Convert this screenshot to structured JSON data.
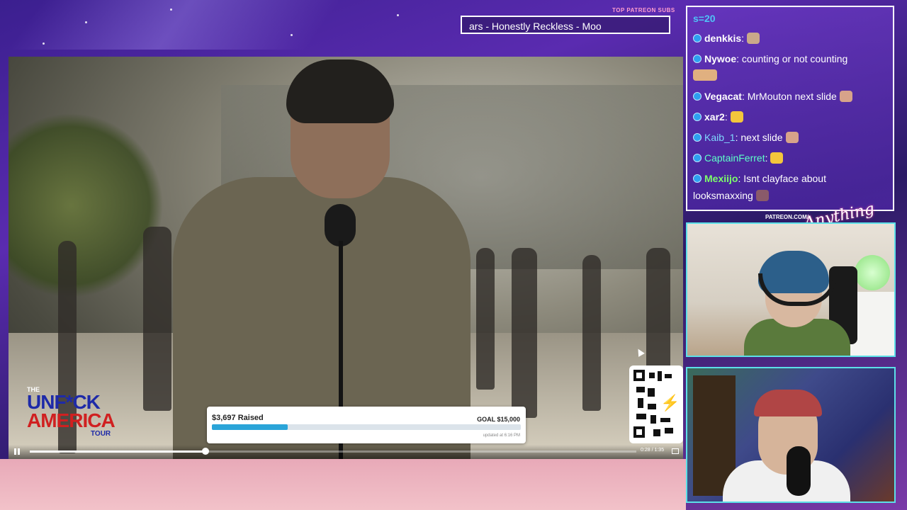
{
  "now_playing": {
    "label": "TOP PATREON SUBS",
    "text": "ars - Honestly Reckless - Moo"
  },
  "video": {
    "logo": {
      "line1": "THE",
      "line2": "UNF*CK",
      "line3": "AMERICA",
      "line4": "TOUR"
    },
    "donation": {
      "raised": "$3,697 Raised",
      "goal": "GOAL $15,000",
      "progress": 0.2465,
      "updated": "updated at 6:16 PM"
    },
    "player": {
      "progress": 0.29,
      "time": "0:28 / 1:35"
    }
  },
  "chat": {
    "top_line": "s=20",
    "messages": [
      {
        "user": "denkkis",
        "text": "",
        "user_color": "#ffffff",
        "emote_color": "#c9a98a"
      },
      {
        "user": "Nywoe",
        "text": "counting or not counting",
        "user_color": "#ffffff",
        "emote_color": "#e0b080"
      },
      {
        "user": "Vegacat",
        "text": "MrMouton next slide",
        "user_color": "#ffffff",
        "emote_color": "#d7a38a"
      },
      {
        "user": "xar2",
        "text": "",
        "user_color": "#ffffff",
        "emote_color": "#f3c63c"
      },
      {
        "user": "Kaib_1",
        "text": "next slide",
        "user_color": "#7fd8ff",
        "emote_color": "#d7a38a"
      },
      {
        "user": "CaptainFerret",
        "text": "",
        "user_color": "#5dffc8",
        "emote_color": "#f3c63c"
      },
      {
        "user": "Mexiijo",
        "text": "Isnt clayface about",
        "text2": "looksmaxxing",
        "user_color": "#7dff6a",
        "emote_color": "#8a5a6a"
      }
    ]
  },
  "sidebar": {
    "patreon_label": "PATREON.COM/",
    "brand": "Anything Else"
  },
  "colors": {
    "frame_accent": "#5ce0e8",
    "donation_bar": "#2aa4d8",
    "chat_username_teal": "#4fc3f7"
  }
}
